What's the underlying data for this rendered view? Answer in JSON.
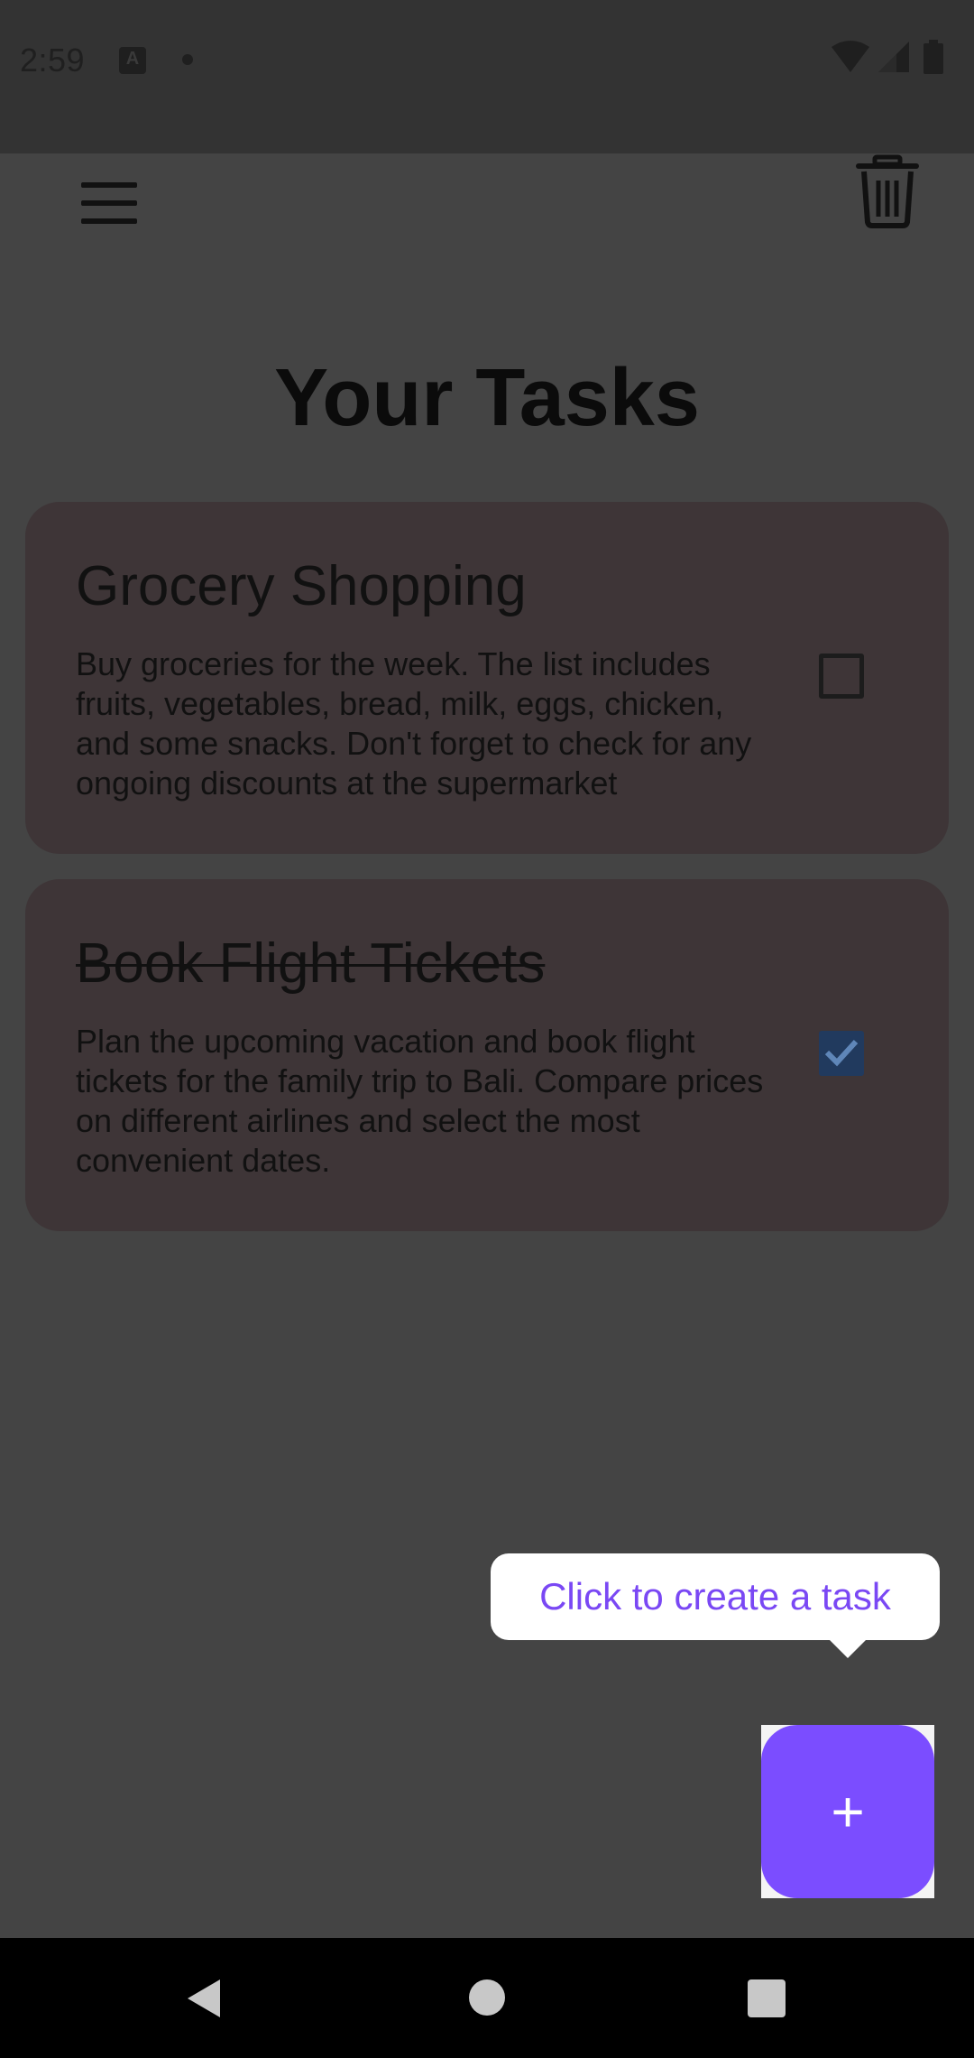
{
  "status_bar": {
    "time": "2:59"
  },
  "app_bar": {
    "menu_icon": "hamburger-menu-icon",
    "delete_icon": "trash-icon"
  },
  "page": {
    "title": "Your Tasks"
  },
  "tasks": [
    {
      "title": "Grocery Shopping",
      "description": "Buy groceries for the week. The list includes fruits, vegetables, bread, milk, eggs, chicken, and some snacks. Don't forget to check for any ongoing discounts at the supermarket",
      "completed": false
    },
    {
      "title": "Book Flight Tickets",
      "description": "Plan the upcoming vacation and book flight tickets for the family trip to Bali. Compare prices on different airlines and select the most convenient dates.",
      "completed": true
    }
  ],
  "tooltip": {
    "text": "Click to create a task"
  },
  "fab": {
    "label": "+"
  },
  "colors": {
    "overlay_background": "#444444",
    "card_background": "#3e3537",
    "accent": "#7b4dff",
    "tooltip_text": "#7a48f4",
    "checkbox_checked": "#213a5e"
  }
}
